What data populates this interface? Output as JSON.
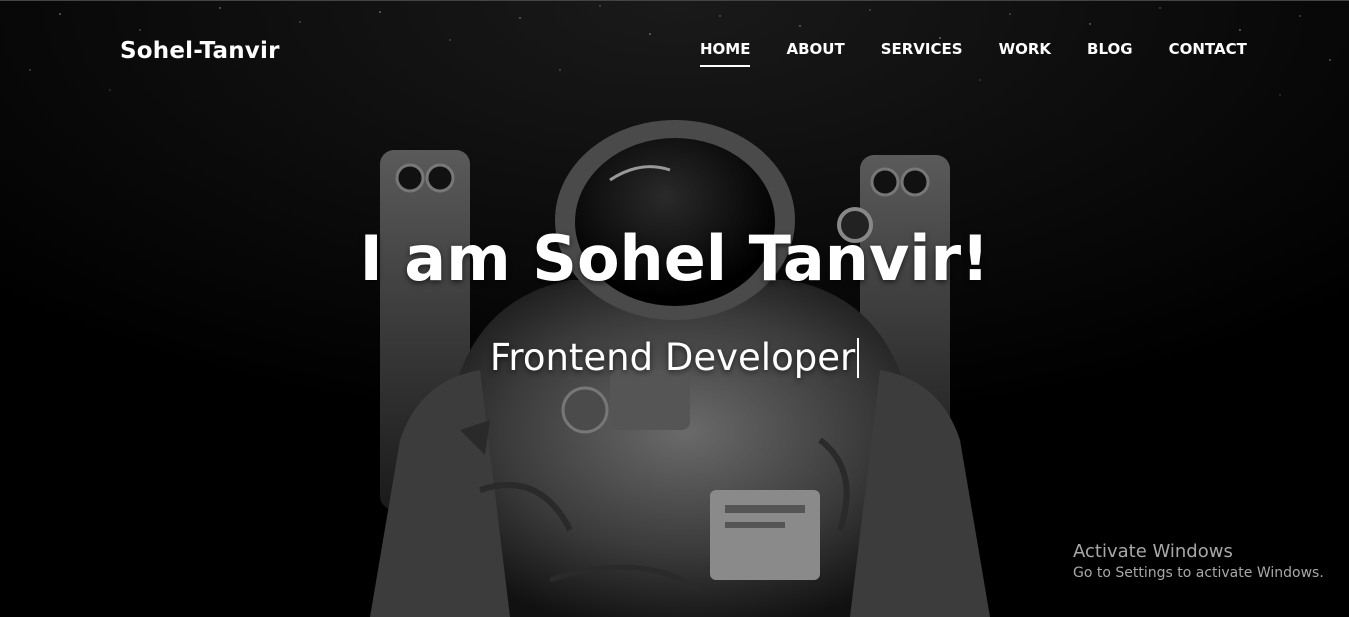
{
  "nav": {
    "brand": "Sohel-Tanvir",
    "links": [
      {
        "label": "HOME",
        "active": true
      },
      {
        "label": "ABOUT",
        "active": false
      },
      {
        "label": "SERVICES",
        "active": false
      },
      {
        "label": "WORK",
        "active": false
      },
      {
        "label": "BLOG",
        "active": false
      },
      {
        "label": "CONTACT",
        "active": false
      }
    ]
  },
  "hero": {
    "headline": "I am Sohel Tanvir!",
    "subline": "Frontend Developer",
    "background_image": "astronaut-in-space",
    "colors": {
      "background": "#000000",
      "text": "#ffffff"
    }
  },
  "watermark": {
    "title": "Activate Windows",
    "subtitle": "Go to Settings to activate Windows."
  }
}
